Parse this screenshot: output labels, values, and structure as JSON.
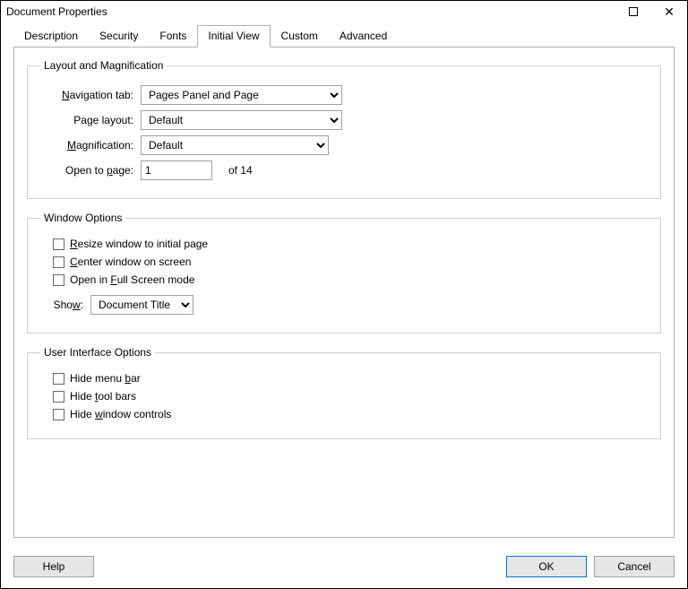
{
  "window": {
    "title": "Document Properties"
  },
  "tabs": {
    "description": "Description",
    "security": "Security",
    "fonts": "Fonts",
    "initial_view": "Initial View",
    "custom": "Custom",
    "advanced": "Advanced"
  },
  "layout_group": {
    "legend": "Layout and Magnification",
    "nav_tab_label_pre": "N",
    "nav_tab_label_post": "avigation tab:",
    "nav_tab_value": "Pages Panel and Page",
    "page_layout_label": "Page layout:",
    "page_layout_value": "Default",
    "magnification_label_pre": "M",
    "magnification_label_post": "agnification:",
    "magnification_value": "Default",
    "open_to_label_pre": "Open to ",
    "open_to_label_u": "p",
    "open_to_label_post": "age:",
    "open_to_value": "1",
    "of_text": "of 14"
  },
  "window_group": {
    "legend": "Window Options",
    "resize_pre": "R",
    "resize_post": "esize window to initial page",
    "center_pre": "C",
    "center_post": "enter window on screen",
    "fullscreen_pre": "Open in ",
    "fullscreen_u": "F",
    "fullscreen_post": "ull Screen mode",
    "show_label_pre": "Sho",
    "show_label_u": "w",
    "show_label_post": ":",
    "show_value": "Document Title"
  },
  "ui_group": {
    "legend": "User Interface Options",
    "menu_pre": "Hide menu ",
    "menu_u": "b",
    "menu_post": "ar",
    "tool_pre": "Hide ",
    "tool_u": "t",
    "tool_post": "ool bars",
    "win_pre": "Hide ",
    "win_u": "w",
    "win_post": "indow controls"
  },
  "buttons": {
    "help": "Help",
    "ok": "OK",
    "cancel": "Cancel"
  }
}
